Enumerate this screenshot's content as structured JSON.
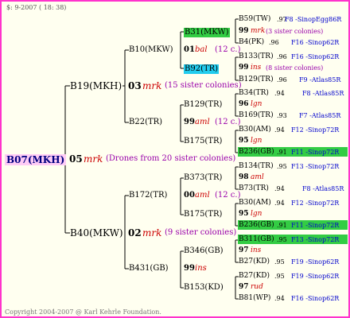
{
  "header": {
    "date": "$:  9-2007 ( 18: 38)"
  },
  "footer": {
    "copyright": "Copyright 2004-2007 @ Karl Kehrle Foundation."
  },
  "colors": {
    "border": "#ff33cc",
    "highlight_green": "#33cc44",
    "highlight_cyan": "#22ccee",
    "root_bg": "#ffccf5",
    "marker_red": "#cc0000",
    "note_purple": "#9900aa",
    "link_blue": "#0000cc"
  },
  "root": {
    "label": "B07(MKH)",
    "year": "05",
    "type": "mrk",
    "note": "(Drones from 20 sister colonies)"
  },
  "gen1": [
    {
      "label": "B19(MKH)",
      "year": "03",
      "type": "mrk",
      "note": "(15 sister colonies)"
    },
    {
      "label": "B40(MKW)",
      "year": "02",
      "type": "mrk",
      "note": "(9 sister colonies)"
    }
  ],
  "gen2": [
    {
      "label": "B10(MKW)",
      "year": "01",
      "type": "bal",
      "note": "(12 c.)"
    },
    {
      "label": "B22(TR)",
      "year": "99",
      "type": "aml",
      "note": "(12 c.)"
    },
    {
      "label": "B172(TR)",
      "year": "00",
      "type": "aml",
      "note": "(12 c.)"
    },
    {
      "label": "B431(GB)",
      "year": "99",
      "type": "ins",
      "note": ""
    }
  ],
  "gen3": [
    {
      "label": "B31(MKW)",
      "year": "99",
      "type": "mrk",
      "note": "(3 sister colonies)"
    },
    {
      "label": "B92(TR)",
      "year": "99",
      "type": "ins",
      "note": "(8 sister colonies)"
    },
    {
      "label": "B129(TR)",
      "year": "96",
      "type": "lgn",
      "note": ""
    },
    {
      "label": "B175(TR)",
      "year": "95",
      "type": "lgn",
      "note": ""
    },
    {
      "label": "B373(TR)",
      "year": "98",
      "type": "aml",
      "note": ""
    },
    {
      "label": "B175(TR)",
      "year": "95",
      "type": "lgn",
      "note": ""
    },
    {
      "label": "B346(GB)",
      "year": "97",
      "type": "ins",
      "note": ""
    },
    {
      "label": "B153(KD)",
      "year": "97",
      "type": "rud",
      "note": ""
    }
  ],
  "gen4": [
    {
      "label": "B59(TW)",
      "score": ".97",
      "source": "F8 -SinopEgg86R"
    },
    {
      "label": "B4(PK)",
      "score": ".96",
      "source": "F16 -Sinop62R"
    },
    {
      "label": "B133(TR)",
      "score": ".96",
      "source": "F16 -Sinop62R"
    },
    {
      "label": "B129(TR)",
      "score": ".96",
      "source": "F9 -Atlas85R"
    },
    {
      "label": "B34(TR)",
      "score": ".94",
      "source": "F8 -Atlas85R"
    },
    {
      "label": "B169(TR)",
      "score": ".93",
      "source": "F7 -Atlas85R"
    },
    {
      "label": "B30(AM)",
      "score": ".94",
      "source": "F12 -Sinop72R"
    },
    {
      "label": "B236(GB)",
      "score": ".91",
      "source": "F11 -Sinop72R"
    },
    {
      "label": "B134(TR)",
      "score": ".95",
      "source": "F13 -Sinop72R"
    },
    {
      "label": "B73(TR)",
      "score": ".94",
      "source": "F8 -Atlas85R"
    },
    {
      "label": "B30(AM)",
      "score": ".94",
      "source": "F12 -Sinop72R"
    },
    {
      "label": "B236(GB)",
      "score": ".91",
      "source": "F11 -Sinop72R"
    },
    {
      "label": "B311(GB)",
      "score": ".95",
      "source": "F13 -Sinop72R"
    },
    {
      "label": "B27(KD)",
      "score": ".95",
      "source": "F19 -Sinop62R"
    },
    {
      "label": "B27(KD)",
      "score": ".95",
      "source": "F19 -Sinop62R"
    },
    {
      "label": "B81(WP)",
      "score": ".94",
      "source": "F16 -Sinop62R"
    }
  ]
}
